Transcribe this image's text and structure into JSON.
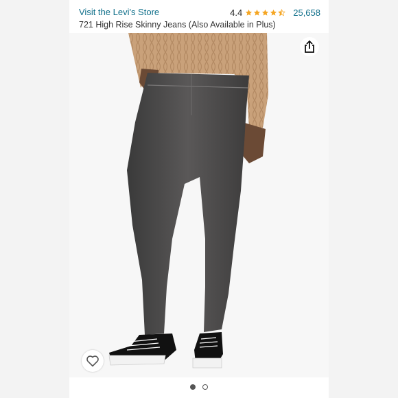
{
  "header": {
    "store_link": "Visit the Levi's Store",
    "rating_value": "4.4",
    "rating_stars": 4.4,
    "review_count": "25,658",
    "title": "721 High Rise Skinny Jeans (Also Available in Plus)"
  },
  "colors": {
    "link": "#0f6f8a",
    "star": "#f5a623",
    "denim": "#4a4949",
    "sweater": "#c9a17a"
  },
  "icons": {
    "share": "share-icon",
    "wishlist": "heart-icon"
  },
  "carousel": {
    "total": 2,
    "active_index": 0
  }
}
